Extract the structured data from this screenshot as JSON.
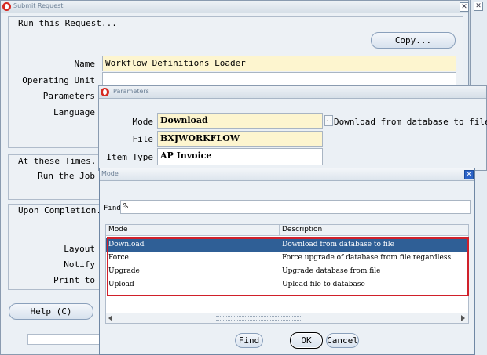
{
  "submit_window": {
    "title": "Submit Request",
    "run_group_title": "Run this Request...",
    "copy_button": "Copy...",
    "name_label": "Name",
    "name_value": "Workflow Definitions Loader",
    "operating_unit_label": "Operating Unit",
    "parameters_label": "Parameters",
    "language_label": "Language",
    "times_group_title": "At these Times...",
    "run_job_label": "Run the Job",
    "completion_group_title": "Upon Completion...",
    "layout_label": "Layout",
    "notify_label": "Notify",
    "print_to_label": "Print to",
    "help_button": "Help (C)",
    "close_glyph": "✕"
  },
  "parameters_window": {
    "title": "Parameters",
    "mode_label": "Mode",
    "mode_value": "Download",
    "mode_lov_glyph": "...",
    "mode_description": "Download from database to file",
    "file_label": "File",
    "file_value": "BXJWORKFLOW",
    "item_type_label": "Item Type",
    "item_type_value": "AP Invoice"
  },
  "mode_dialog": {
    "title": "Mode",
    "find_label": "Find",
    "find_value": "%",
    "columns": [
      "Mode",
      "Description"
    ],
    "rows": [
      {
        "mode": "Download",
        "description": "Download from database to file",
        "selected": true
      },
      {
        "mode": "Force",
        "description": "Force upgrade of database from file regardless",
        "selected": false
      },
      {
        "mode": "Upgrade",
        "description": "Upgrade database from file",
        "selected": false
      },
      {
        "mode": "Upload",
        "description": "Upload file to database",
        "selected": false
      }
    ],
    "find_button": "Find",
    "ok_button": "OK",
    "cancel_button": "Cancel",
    "close_glyph": "✕",
    "highlight_color": "#d0202a",
    "selection_color": "#2f5f96"
  }
}
